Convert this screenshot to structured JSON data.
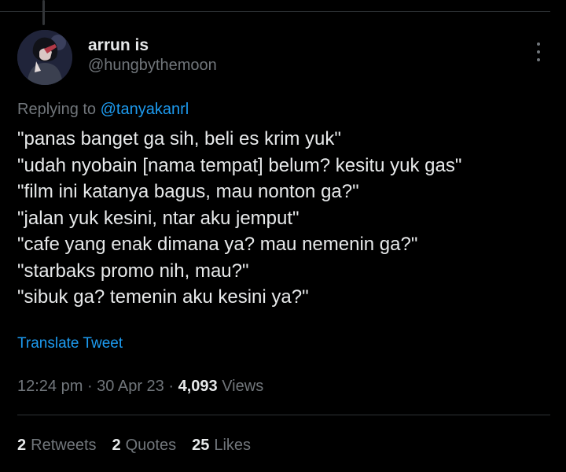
{
  "user": {
    "display_name": "arrun is",
    "handle": "@hungbythemoon"
  },
  "reply": {
    "prefix": "Replying to ",
    "mention": "@tanyakanrl"
  },
  "tweet": {
    "lines": [
      "\"panas banget ga sih, beli es krim yuk\"",
      "\"udah nyobain [nama tempat] belum? kesitu yuk gas\"",
      "\"film ini katanya bagus, mau nonton ga?\"",
      "\"jalan yuk kesini, ntar aku jemput\"",
      "\"cafe yang enak dimana ya? mau nemenin ga?\"",
      "\"starbaks promo nih, mau?\"",
      "\"sibuk ga? temenin aku kesini ya?\""
    ],
    "translate_label": "Translate Tweet"
  },
  "meta": {
    "time": "12:24 pm",
    "date": "30 Apr 23",
    "separator": " · ",
    "views_count": "4,093",
    "views_label": "Views"
  },
  "stats": {
    "retweets_count": "2",
    "retweets_label": "Retweets",
    "quotes_count": "2",
    "quotes_label": "Quotes",
    "likes_count": "25",
    "likes_label": "Likes"
  },
  "icons": {
    "more": "more-options-icon",
    "avatar": "avatar-image"
  },
  "colors": {
    "background": "#000000",
    "text_primary": "#e7e9ea",
    "text_secondary": "#71767b",
    "link": "#1d9bf0",
    "divider": "#2f3336"
  }
}
